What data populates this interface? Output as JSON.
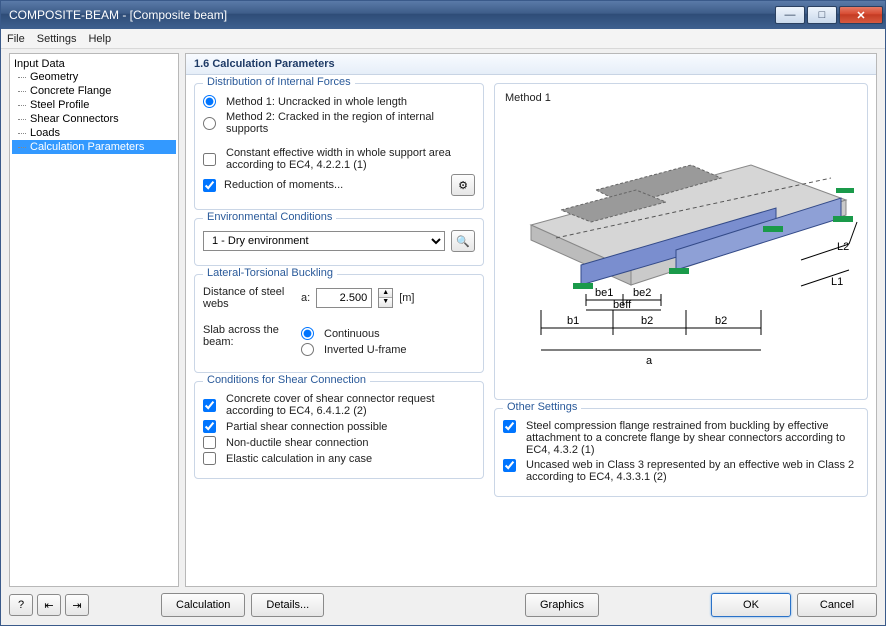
{
  "window": {
    "title": "COMPOSITE-BEAM - [Composite beam]"
  },
  "menu": {
    "file": "File",
    "settings": "Settings",
    "help": "Help"
  },
  "tree": {
    "root": "Input Data",
    "items": [
      "Geometry",
      "Concrete Flange",
      "Steel Profile",
      "Shear Connectors",
      "Loads",
      "Calculation Parameters"
    ],
    "selectedIndex": 5
  },
  "panel": {
    "title": "1.6 Calculation Parameters"
  },
  "distribution": {
    "legend": "Distribution of Internal Forces",
    "method1": "Method 1: Uncracked in whole length",
    "method2": "Method 2: Cracked in the region of internal supports",
    "constWidth": "Constant effective width in whole support area according to EC4, 4.2.2.1 (1)",
    "reduction": "Reduction of moments..."
  },
  "env": {
    "legend": "Environmental Conditions",
    "selected": "1  - Dry environment"
  },
  "ltb": {
    "legend": "Lateral-Torsional Buckling",
    "distLabel": "Distance of steel webs",
    "aLabel": "a:",
    "aValue": "2.500",
    "unit": "[m]",
    "slabLabel": "Slab across the beam:",
    "optCont": "Continuous",
    "optInvU": "Inverted U-frame"
  },
  "shearConn": {
    "legend": "Conditions for Shear Connection",
    "cover": "Concrete cover of shear connector request according to EC4, 6.4.1.2 (2)",
    "partial": "Partial shear connection possible",
    "nonductile": "Non-ductile shear connection",
    "elastic": "Elastic calculation in any case"
  },
  "diagram": {
    "title": "Method 1",
    "labels": {
      "be1": "be1",
      "be2": "be2",
      "beff": "beff",
      "b1": "b1",
      "b2a": "b2",
      "b2b": "b2",
      "a": "a",
      "L1": "L1",
      "L2": "L2"
    }
  },
  "other": {
    "legend": "Other Settings",
    "opt1": "Steel compression flange restrained from buckling by effective attachment to a concrete flange by shear connectors according to EC4, 4.3.2 (1)",
    "opt2": "Uncased web in Class 3 represented by an effective web in Class 2 according to EC4, 4.3.3.1 (2)"
  },
  "footer": {
    "calc": "Calculation",
    "details": "Details...",
    "graphics": "Graphics",
    "ok": "OK",
    "cancel": "Cancel"
  }
}
